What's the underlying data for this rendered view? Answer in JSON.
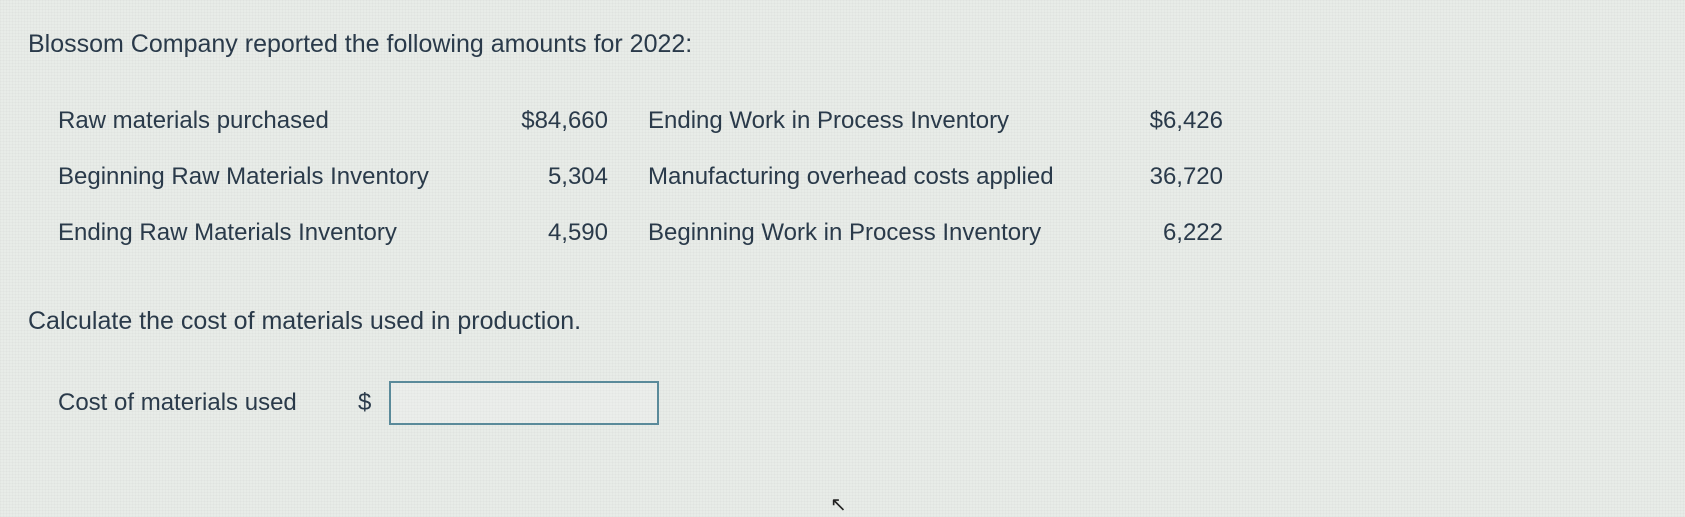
{
  "intro": "Blossom Company reported the following amounts for 2022:",
  "rows": [
    {
      "label_left": "Raw materials purchased",
      "value_left": "$84,660",
      "label_right": "Ending Work in Process Inventory",
      "value_right": "$6,426"
    },
    {
      "label_left": "Beginning Raw Materials Inventory",
      "value_left": "5,304",
      "label_right": "Manufacturing overhead costs applied",
      "value_right": "36,720"
    },
    {
      "label_left": "Ending Raw Materials Inventory",
      "value_left": "4,590",
      "label_right": "Beginning Work in Process Inventory",
      "value_right": "6,222"
    }
  ],
  "instruction": "Calculate the cost of materials used in production.",
  "answer": {
    "label": "Cost of materials used",
    "currency": "$",
    "value": ""
  }
}
